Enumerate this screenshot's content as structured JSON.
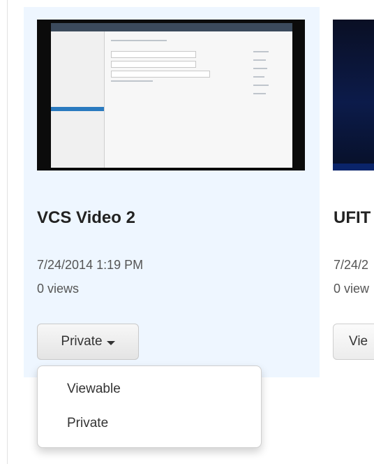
{
  "videos": [
    {
      "title": "VCS Video 2",
      "date": "7/24/2014 1:19 PM",
      "views": "0 views",
      "privacy_button": "Private",
      "privacy_options": [
        "Viewable",
        "Private"
      ]
    },
    {
      "title": "UFIT",
      "date": "7/24/2",
      "views": "0 view",
      "button": "Vie"
    }
  ],
  "icons": {
    "caret": "caret-down-icon"
  }
}
